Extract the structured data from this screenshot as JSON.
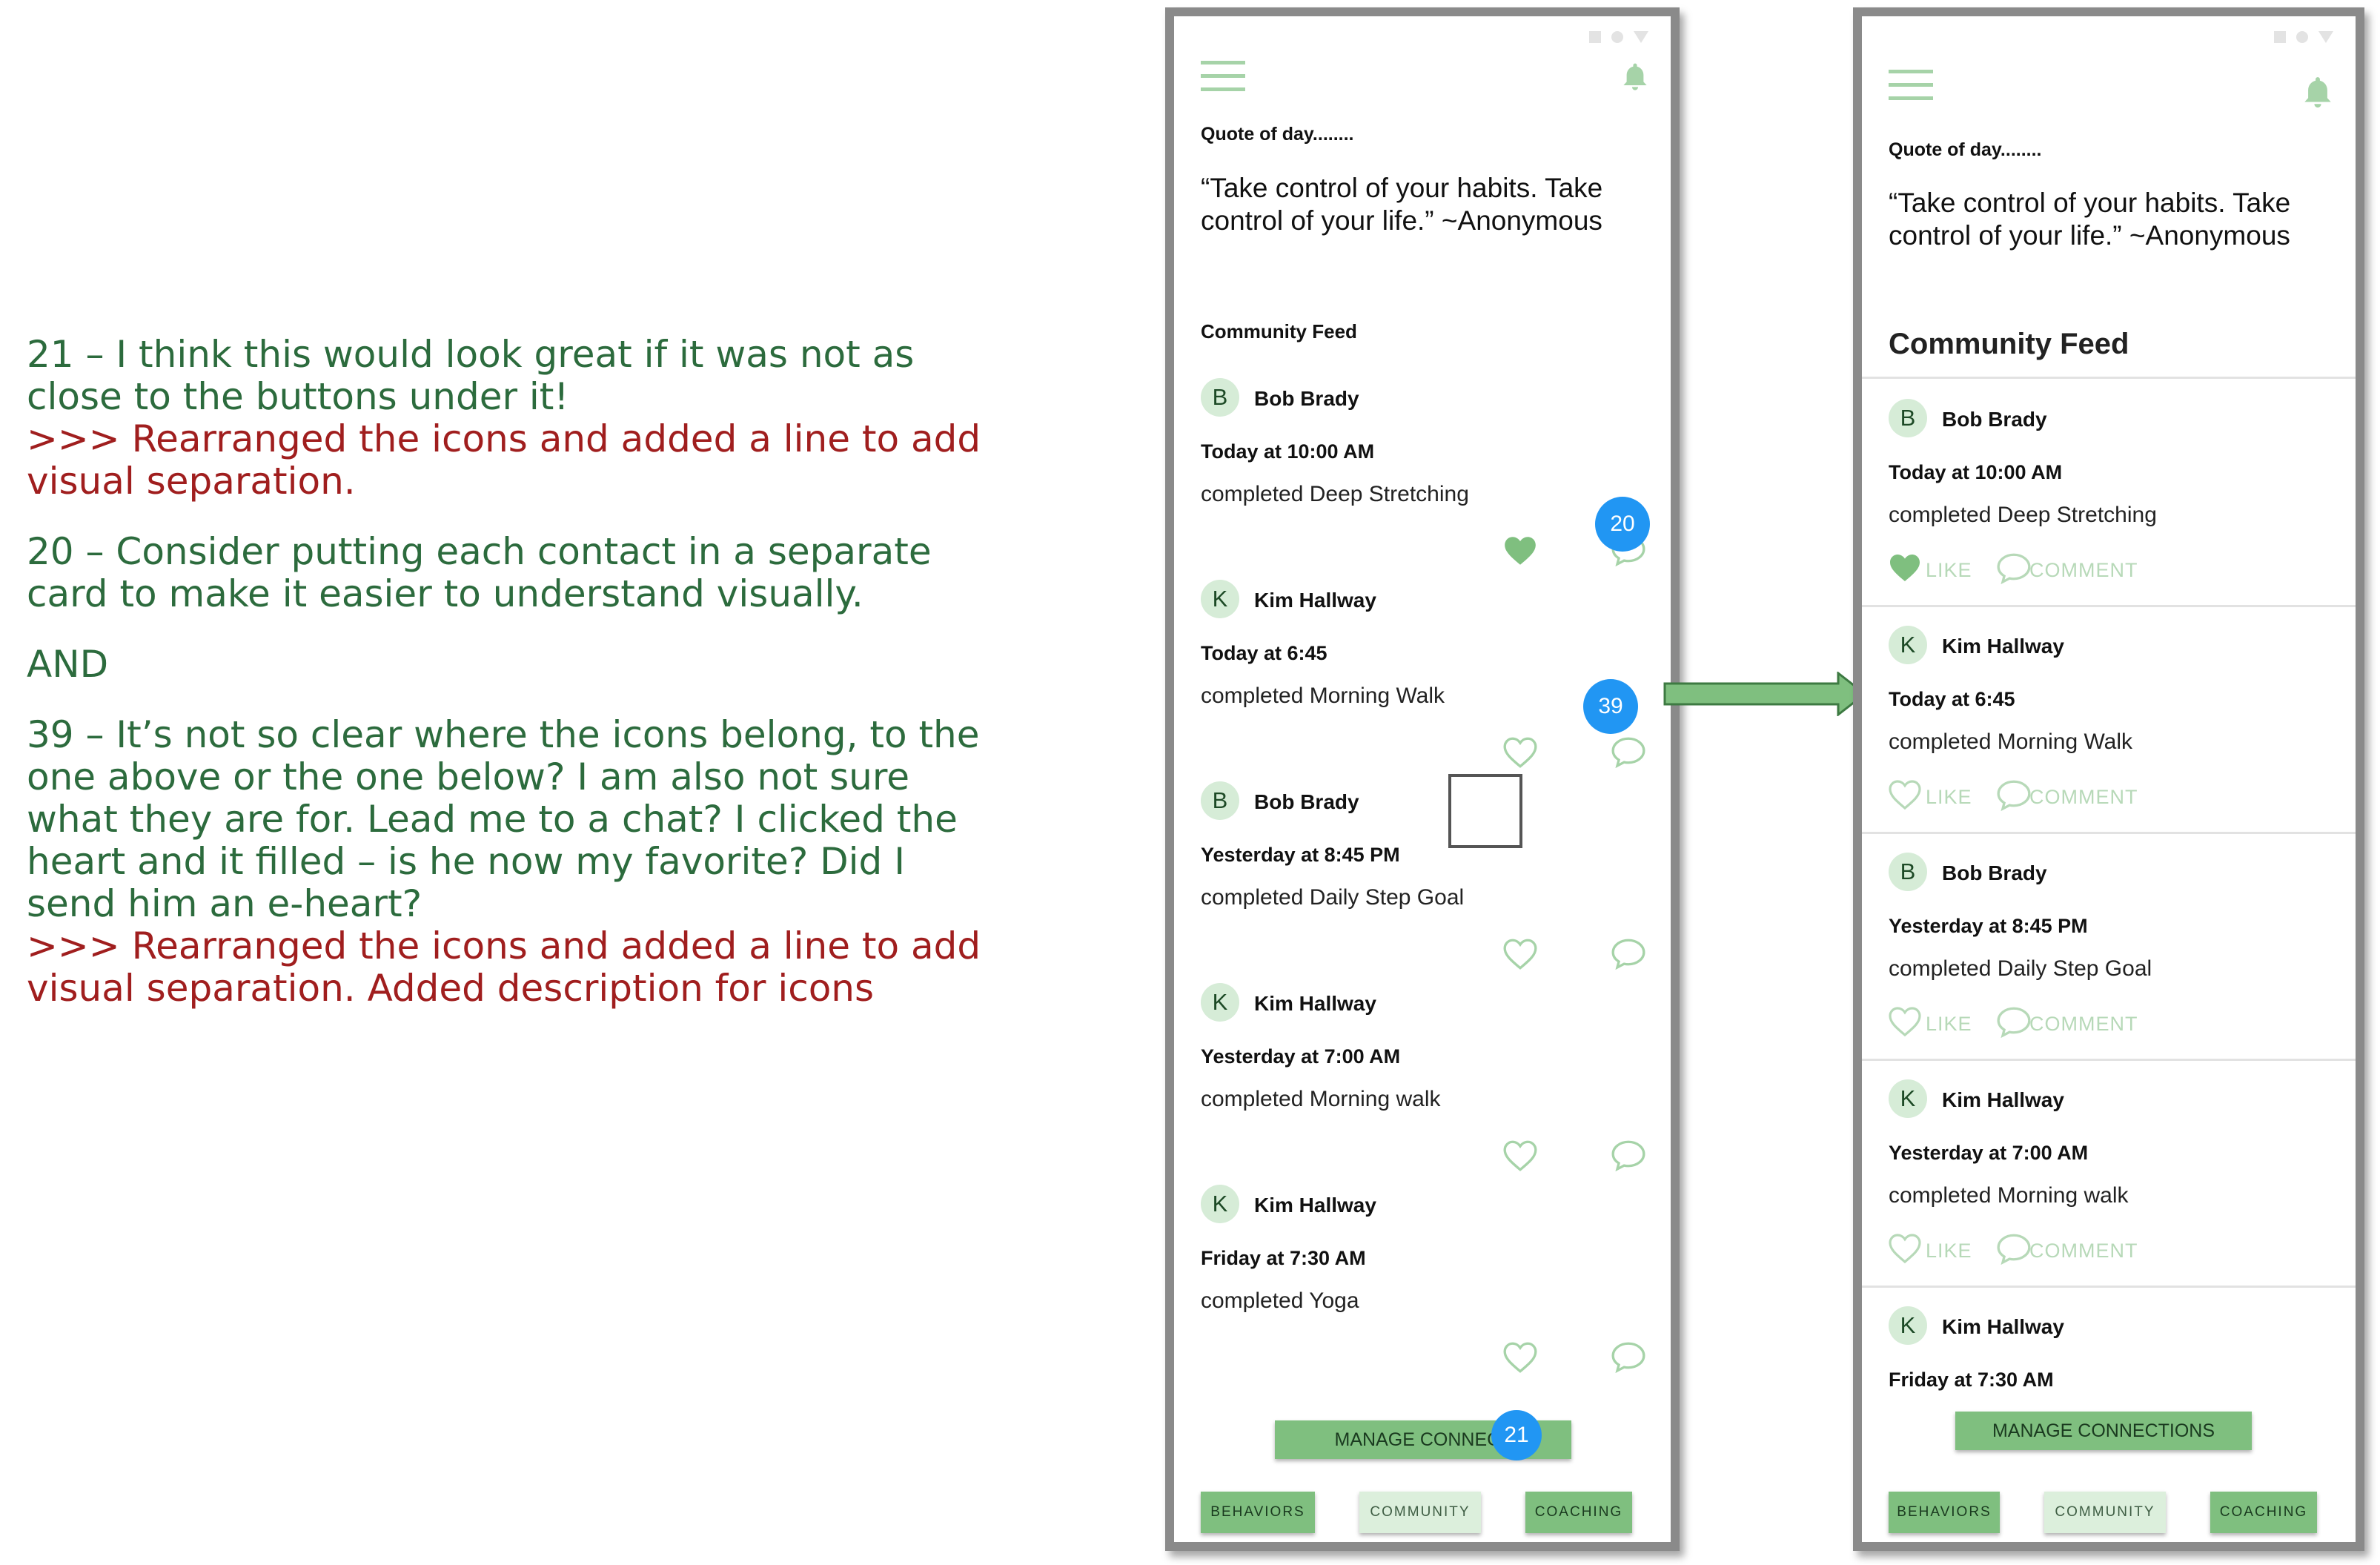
{
  "notes": {
    "n21_comment": "21 – I think this would look great if it was not as close to the buttons under it!",
    "n21_response": ">>> Rearranged the icons and added a line to add visual separation.",
    "n20_comment": "20 – Consider putting each contact in a separate card to make it easier to understand visually.",
    "and": "AND",
    "n39_comment": "39 – It’s not so clear where the icons belong, to the one above or the one below? I am also not sure what they are for. Lead me to a chat? I clicked the heart and it filled – is he now my favorite? Did I send him an e-heart?",
    "n39_response": ">>> Rearranged the icons and added a line to add visual separation. Added description for icons"
  },
  "colors": {
    "note_green": "#2c6b3d",
    "note_red": "#a01e1e",
    "accent_green": "#7fbf7f",
    "light_green": "#a6d3a8",
    "badge_blue": "#2196f3"
  },
  "before": {
    "quote_label": "Quote of day........",
    "quote": "“Take control of your habits. Take control of your life.” ~Anonymous",
    "feed_title": "Community Feed",
    "posts": [
      {
        "initial": "B",
        "name": "Bob Brady",
        "time": "Today at 10:00 AM",
        "activity": "completed Deep Stretching",
        "liked": true
      },
      {
        "initial": "K",
        "name": "Kim Hallway",
        "time": "Today at 6:45",
        "activity": "completed Morning Walk",
        "liked": false
      },
      {
        "initial": "B",
        "name": "Bob Brady",
        "time": "Yesterday at 8:45 PM",
        "activity": "completed Daily Step Goal",
        "liked": false
      },
      {
        "initial": "K",
        "name": "Kim Hallway",
        "time": "Yesterday  at 7:00 AM",
        "activity": "completed Morning walk",
        "liked": false
      },
      {
        "initial": "K",
        "name": "Kim Hallway",
        "time": "Friday at 7:30 AM",
        "activity": "completed Yoga",
        "liked": false
      }
    ],
    "manage_button": "MANAGE CONNECT",
    "badges": {
      "b20": "20",
      "b39": "39",
      "b21": "21"
    },
    "nav": {
      "behaviors": "BEHAVIORS",
      "community": "COMMUNITY",
      "coaching": "COACHING"
    }
  },
  "after": {
    "quote_label": "Quote of day........",
    "quote": "“Take control of your habits. Take control of your life.” ~Anonymous",
    "feed_title": "Community Feed",
    "posts": [
      {
        "initial": "B",
        "name": "Bob Brady",
        "time": "Today at 10:00 AM",
        "activity": "completed Deep Stretching",
        "liked": true
      },
      {
        "initial": "K",
        "name": "Kim Hallway",
        "time": "Today at 6:45",
        "activity": "completed Morning Walk",
        "liked": false
      },
      {
        "initial": "B",
        "name": "Bob Brady",
        "time": "Yesterday at 8:45 PM",
        "activity": "completed Daily Step Goal",
        "liked": false
      },
      {
        "initial": "K",
        "name": "Kim Hallway",
        "time": "Yesterday  at 7:00 AM",
        "activity": "completed Morning walk",
        "liked": false
      },
      {
        "initial": "K",
        "name": "Kim Hallway",
        "time": "Friday at 7:30 AM",
        "activity": "",
        "liked": false
      }
    ],
    "like_label": "LIKE",
    "comment_label": "COMMENT",
    "manage_button": "MANAGE CONNECTIONS",
    "nav": {
      "behaviors": "BEHAVIORS",
      "community": "COMMUNITY",
      "coaching": "COACHING"
    }
  }
}
